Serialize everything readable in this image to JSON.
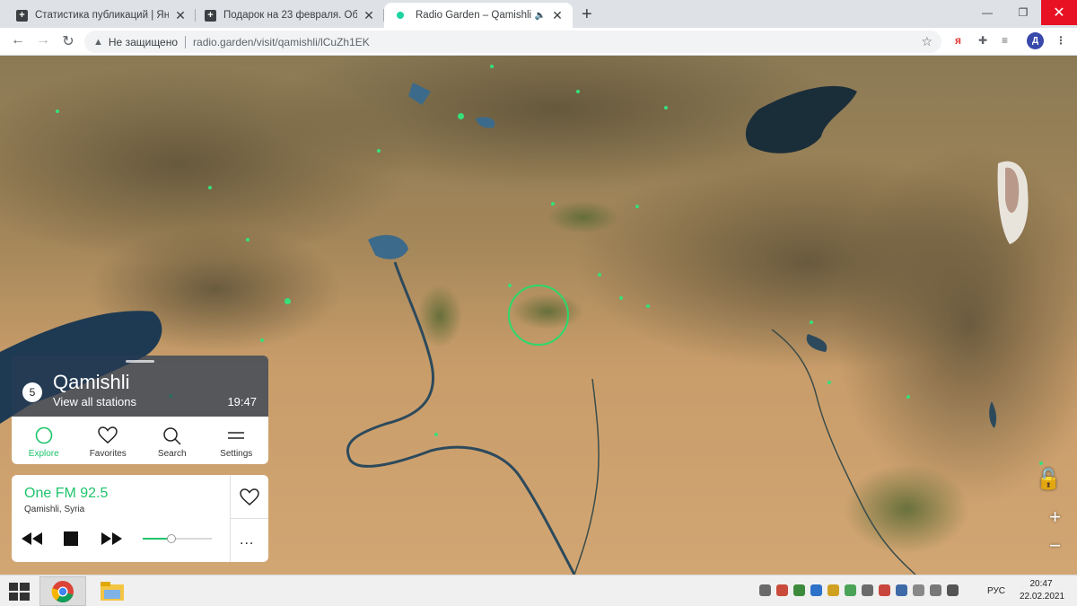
{
  "browser": {
    "tabs": [
      {
        "title": "Статистика публикаций | Яндекс",
        "icon": "plus-square-icon",
        "active": false
      },
      {
        "title": "Подарок на 23 февраля. Общий",
        "icon": "plus-square-icon",
        "active": false
      },
      {
        "title": "Radio Garden – Qamishli",
        "icon": "radio-garden-dot-icon",
        "active": true
      }
    ],
    "new_tab_label": "+",
    "security_label": "Не защищено",
    "url": "radio.garden/visit/qamishli/lCuZh1EK",
    "yandex_ext_label": "я",
    "profile_initial": "Д"
  },
  "radio": {
    "location": {
      "station_count": "5",
      "name": "Qamishli",
      "view_all": "View all stations",
      "local_time": "19:47"
    },
    "nav": [
      {
        "label": "Explore",
        "icon": "explore-circle-icon",
        "active": true
      },
      {
        "label": "Favorites",
        "icon": "heart-icon",
        "active": false
      },
      {
        "label": "Search",
        "icon": "search-icon",
        "active": false
      },
      {
        "label": "Settings",
        "icon": "menu-icon",
        "active": false
      }
    ],
    "player": {
      "station_name": "One FM 92.5",
      "station_location": "Qamishli, Syria",
      "volume": 0.42,
      "more_label": "..."
    },
    "accent_color": "#1ec46b"
  },
  "taskbar": {
    "language": "РУС",
    "time": "20:47",
    "date": "22.02.2021"
  }
}
